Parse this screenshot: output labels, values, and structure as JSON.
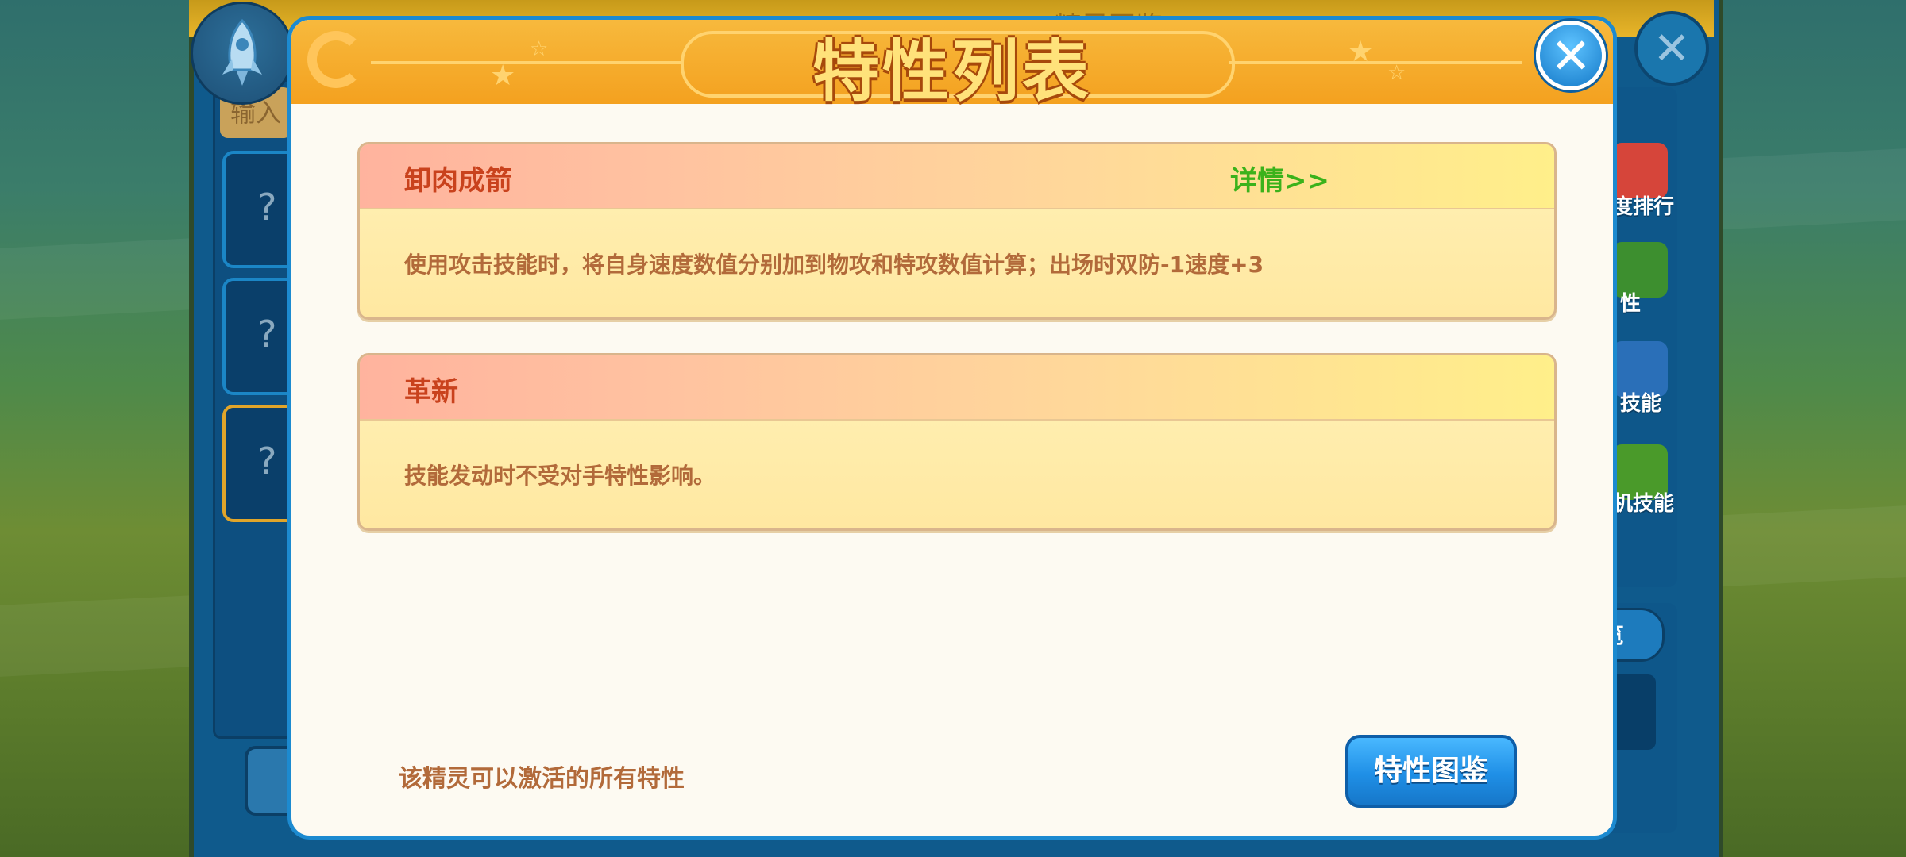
{
  "background": {
    "under_title": "精灵图鉴",
    "input_label": "输入",
    "slot_glyph": "?",
    "right_labels": [
      "度排行",
      "性",
      "技能",
      "机技能"
    ],
    "right_pill": "览"
  },
  "modal": {
    "title": "特性列表",
    "close_glyph": "✕"
  },
  "traits": [
    {
      "name": "卸肉成箭",
      "detail_link": "详情>>",
      "description": "使用攻击技能时，将自身速度数值分别加到物攻和特攻数值计算；出场时双防-1速度+3"
    },
    {
      "name": "革新",
      "description": "技能发动时不受对手特性影响。"
    }
  ],
  "footer": {
    "note": "该精灵可以激活的所有特性",
    "atlas_button": "特性图鉴"
  },
  "colors": {
    "modal_border": "#1c8ad0",
    "header": "#f4a11f",
    "trait_name": "#c9421d",
    "detail_link": "#3bb21b",
    "description": "#b26a3a",
    "button": "#1f8fe6"
  }
}
